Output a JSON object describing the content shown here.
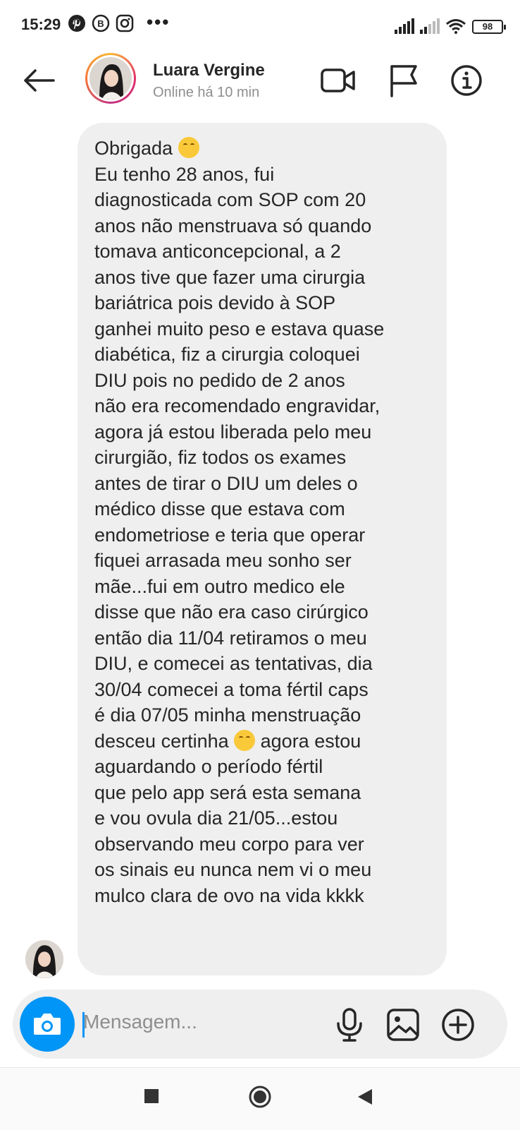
{
  "status_bar": {
    "time": "15:29",
    "battery": "98",
    "left_icons": [
      "pinterest-icon",
      "b-app-icon",
      "instagram-icon"
    ],
    "more": "•••"
  },
  "header": {
    "name": "Luara Vergine",
    "status": "Online há 10 min",
    "icons": [
      "back-arrow-icon",
      "video-call-icon",
      "flag-icon",
      "info-icon"
    ]
  },
  "message": {
    "line_1": "Obrigada",
    "body_a": "Eu tenho 28 anos, fui\ndiagnosticada com SOP com 20\nanos não menstruava só quando\ntomava anticoncepcional, a 2\nanos tive que fazer uma cirurgia\nbariátrica pois devido à SOP\nganhei muito peso e estava quase\ndiabética, fiz a cirurgia coloquei\nDIU pois no pedido de 2 anos\nnão era recomendado engravidar,\nagora já estou liberada pelo meu\ncirurgião, fiz todos os exames\nantes de tirar o DIU um deles o\nmédico disse que estava com\nendometriose e teria que operar\nfiquei arrasada meu sonho ser\nmãe...fui em outro medico ele\ndisse que não era caso cirúrgico\nentão dia 11/04 retiramos o meu\nDIU, e comecei as tentativas, dia\n30/04 comecei a toma fértil caps\né dia 07/05 minha menstruação\ndesceu certinha",
    "body_b": " agora estou\naguardando o período fértil\nque pelo app será esta semana\ne vou ovula dia 21/05...estou\nobservando meu corpo para ver\nos sinais eu nunca nem vi o meu\nmulco clara de ovo na vida kkkk",
    "emoji": "smiling-face-emoji"
  },
  "composer": {
    "placeholder": "Mensagem...",
    "icons": [
      "camera-icon",
      "microphone-icon",
      "gallery-icon",
      "plus-circle-icon"
    ]
  },
  "nav": {
    "icons": [
      "recents-square-icon",
      "home-circle-icon",
      "back-triangle-icon"
    ]
  },
  "colors": {
    "accent": "#0095f6",
    "bubble": "#efefef",
    "text": "#262626",
    "secondary_text": "#8e8e8e"
  }
}
